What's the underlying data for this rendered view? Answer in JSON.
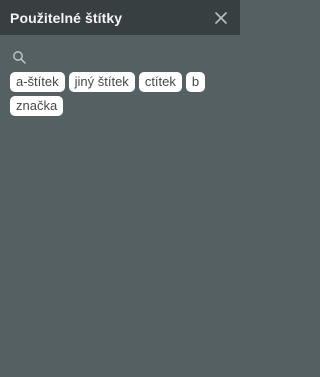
{
  "panel": {
    "title": "Použitelné štítky",
    "close_icon": "close-icon"
  },
  "search": {
    "icon": "search-icon",
    "value": "",
    "placeholder": ""
  },
  "tags": [
    {
      "label": "a-štítek"
    },
    {
      "label": "jiný štítek"
    },
    {
      "label": "ctítek"
    },
    {
      "label": "b"
    },
    {
      "label": "značka"
    }
  ],
  "colors": {
    "header_bg": "#373f41",
    "panel_bg": "#556062",
    "tag_bg": "#ffffff",
    "tag_text": "#45494a"
  }
}
